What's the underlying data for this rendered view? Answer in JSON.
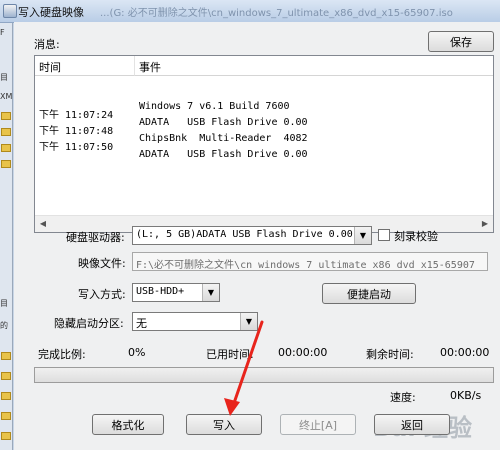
{
  "window": {
    "title": "写入硬盘映像",
    "ghost_path": "...(G: 必不可删除之文件\\cn_windows_7_ultimate_x86_dvd_x15-65907.iso"
  },
  "background_app": {
    "items": [
      "F",
      "目",
      "XM",
      "目",
      "的"
    ]
  },
  "messages": {
    "label": "消息:",
    "save_button": "保存",
    "columns": [
      "时间",
      "事件"
    ],
    "rows": [
      {
        "time": "",
        "event": "Windows 7 v6.1 Build 7600"
      },
      {
        "time": "下午 11:07:24",
        "event": "ADATA   USB Flash Drive 0.00"
      },
      {
        "time": "下午 11:07:48",
        "event": "ChipsBnk  Multi-Reader  4082"
      },
      {
        "time": "下午 11:07:50",
        "event": "ADATA   USB Flash Drive 0.00"
      }
    ]
  },
  "form": {
    "drive_label": "硬盘驱动器:",
    "drive_value": "(L:, 5 GB)ADATA   USB Flash Drive 0.00",
    "verify_label": "刻录校验",
    "image_label": "映像文件:",
    "image_value": "F:\\必不可删除之文件\\cn_windows_7_ultimate_x86_dvd_x15-65907",
    "method_label": "写入方式:",
    "method_value": "USB-HDD+",
    "boot_button": "便捷启动",
    "hidden_label": "隐藏启动分区:",
    "hidden_value": "无"
  },
  "status": {
    "complete_label": "完成比例:",
    "complete_value": "0%",
    "elapsed_label": "已用时间:",
    "elapsed_value": "00:00:00",
    "remaining_label": "剩余时间:",
    "remaining_value": "00:00:00",
    "speed_label": "速度:",
    "speed_value": "0KB/s",
    "progress": 0
  },
  "buttons": {
    "format": "格式化",
    "write": "写入",
    "abort": "终止[A]",
    "back": "返回"
  },
  "watermark": "Bai 经验",
  "annotation": {
    "color": "#e8241c"
  }
}
